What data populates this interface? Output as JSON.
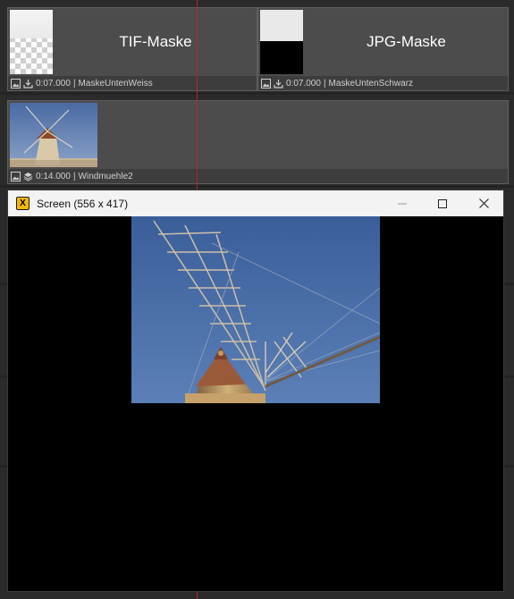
{
  "clips": [
    {
      "title": "TIF-Maske",
      "duration": "0:07.000",
      "name": "MaskeUntenWeiss",
      "media_icon": "image-icon",
      "type_icon": "import-icon"
    },
    {
      "title": "JPG-Maske",
      "duration": "0:07.000",
      "name": "MaskeUntenSchwarz",
      "media_icon": "image-icon",
      "type_icon": "import-icon"
    },
    {
      "title": "",
      "duration": "0:14.000",
      "name": "Windmuehle2",
      "media_icon": "image-icon",
      "type_icon": "layers-icon"
    }
  ],
  "info_separator": "|",
  "screen_window": {
    "title": "Screen (556 x 417)",
    "app_icon_letter": "X",
    "minimize_glyph": "—",
    "maximize_glyph": "☐",
    "close_glyph": "✕"
  },
  "colors": {
    "playhead": "#b3262b",
    "timeline_bg": "#2b2b2b",
    "clip_bg": "#4c4c4c",
    "sky": "#3f64a0"
  }
}
